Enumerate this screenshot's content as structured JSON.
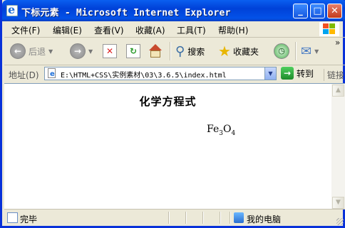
{
  "window": {
    "title": "下标元素 - Microsoft Internet Explorer"
  },
  "title_buttons": {
    "minimize": "_",
    "maximize": "□",
    "close": "✕"
  },
  "menu": {
    "items": [
      {
        "label": "文件(F)"
      },
      {
        "label": "编辑(E)"
      },
      {
        "label": "查看(V)"
      },
      {
        "label": "收藏(A)"
      },
      {
        "label": "工具(T)"
      },
      {
        "label": "帮助(H)"
      }
    ]
  },
  "toolbar": {
    "back_label": "后退",
    "search_label": "搜索",
    "favorites_label": "收藏夹",
    "overflow": "»"
  },
  "address": {
    "label": "地址(D)",
    "value": "E:\\HTML+CSS\\实例素材\\03\\3.6.5\\index.html",
    "go_label": "转到",
    "links_label": "链接"
  },
  "page": {
    "heading": "化学方程式",
    "formula": {
      "base1": "Fe",
      "sub1": "3",
      "base2": "O",
      "sub2": "4"
    }
  },
  "status": {
    "text": "完毕",
    "zone": "我的电脑"
  },
  "icons": {
    "app": "ie-icon",
    "back": "back-arrow-icon",
    "forward": "forward-arrow-icon",
    "stop": "stop-icon",
    "refresh": "refresh-icon",
    "home": "home-icon",
    "search": "search-icon",
    "favorites": "star-icon",
    "history": "history-icon",
    "mail": "mail-icon",
    "page": "page-icon",
    "go": "go-arrow-icon",
    "computer": "computer-icon"
  }
}
